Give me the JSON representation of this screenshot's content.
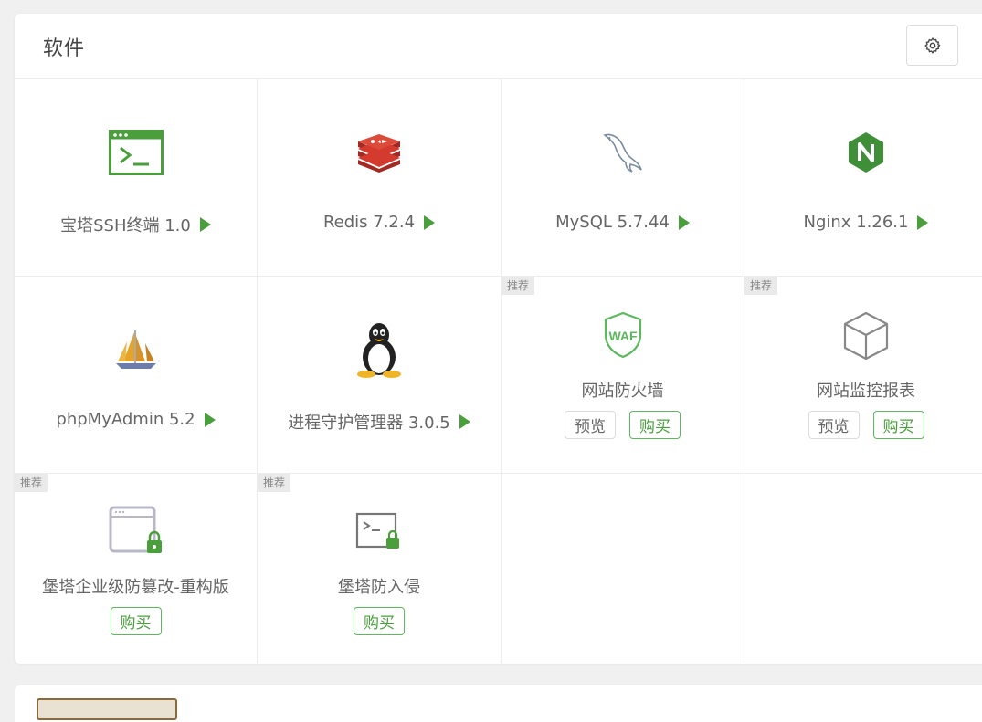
{
  "panel": {
    "title": "软件",
    "settings_icon": "gear-icon"
  },
  "apps": [
    {
      "name": "宝塔SSH终端 1.0",
      "icon": "terminal-window-icon",
      "action": "play"
    },
    {
      "name": "Redis 7.2.4",
      "icon": "redis-icon",
      "action": "play"
    },
    {
      "name": "MySQL 5.7.44",
      "icon": "mysql-dolphin-icon",
      "action": "play"
    },
    {
      "name": "Nginx 1.26.1",
      "icon": "nginx-icon",
      "action": "play"
    },
    {
      "name": "phpMyAdmin 5.2",
      "icon": "phpmyadmin-sailboat-icon",
      "action": "play"
    },
    {
      "name": "进程守护管理器 3.0.5",
      "icon": "linux-penguin-icon",
      "action": "play"
    }
  ],
  "recommended": [
    {
      "badge": "推荐",
      "name": "网站防火墙",
      "icon": "waf-shield-icon",
      "icon_text": "WAF",
      "preview_label": "预览",
      "buy_label": "购买"
    },
    {
      "badge": "推荐",
      "name": "网站监控报表",
      "icon": "cube-icon",
      "preview_label": "预览",
      "buy_label": "购买"
    },
    {
      "badge": "推荐",
      "name": "堡塔企业级防篡改-重构版",
      "icon": "locked-browser-icon",
      "buy_label": "购买"
    },
    {
      "badge": "推荐",
      "name": "堡塔防入侵",
      "icon": "locked-terminal-icon",
      "buy_label": "购买"
    }
  ],
  "colors": {
    "accent_green": "#4a9f3c",
    "redis_red": "#c0392b",
    "nginx_green": "#3f8f38",
    "border": "#ececec"
  }
}
